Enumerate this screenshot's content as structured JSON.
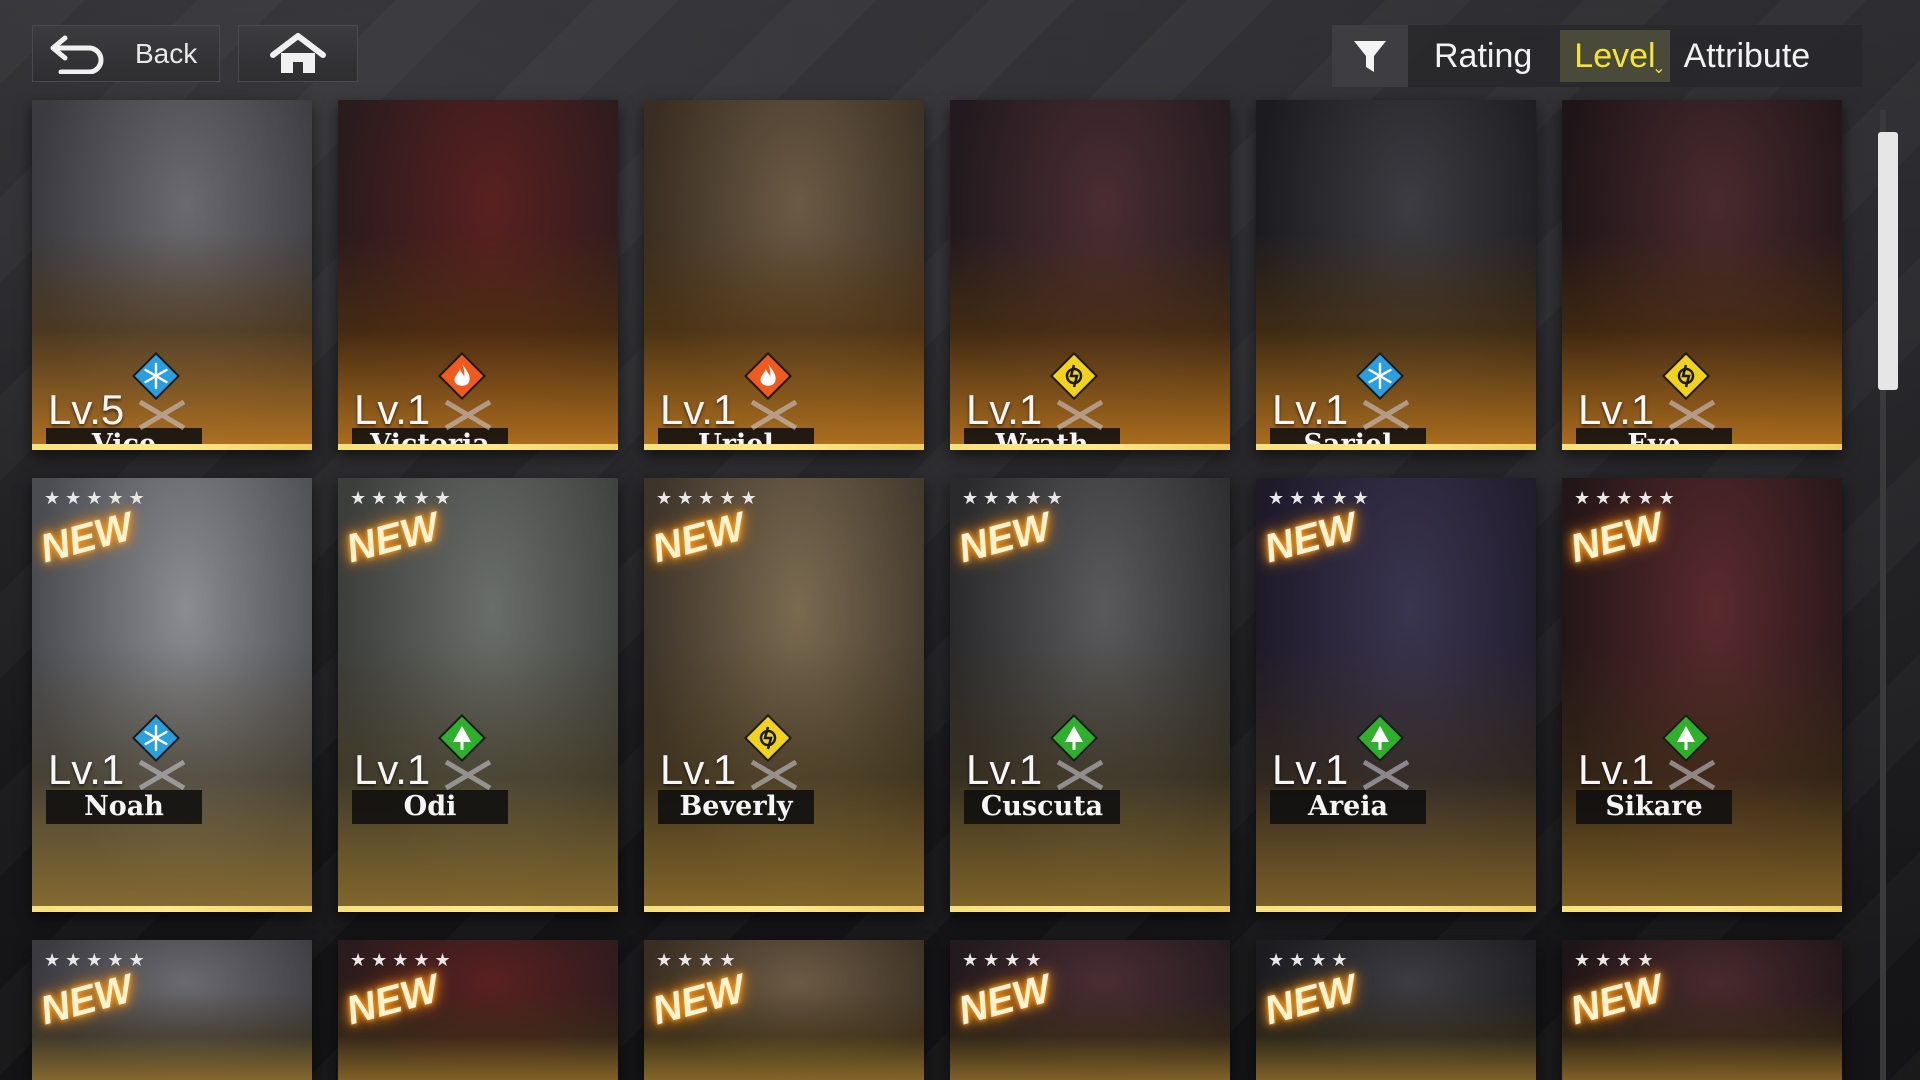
{
  "topbar": {
    "back_label": "Back",
    "home_icon": "home-icon",
    "filter_icon": "filter-icon",
    "sort_options": [
      {
        "label": "Rating",
        "active": false
      },
      {
        "label": "Level",
        "active": true
      },
      {
        "label": "Attribute",
        "active": false
      }
    ]
  },
  "colors": {
    "active_sort": "#f4e43a",
    "ice": "#2a9fe0",
    "fire": "#f05a1e",
    "electric": "#f2d21a",
    "nature": "#2fb02c"
  },
  "rows": [
    {
      "cards": [
        {
          "name": "Vice",
          "level": "Lv.5",
          "attribute": "ice",
          "new": false,
          "stars": ""
        },
        {
          "name": "Victoria",
          "level": "Lv.1",
          "attribute": "fire",
          "new": false,
          "stars": ""
        },
        {
          "name": "Uriel",
          "level": "Lv.1",
          "attribute": "fire",
          "new": false,
          "stars": ""
        },
        {
          "name": "Wrath",
          "level": "Lv.1",
          "attribute": "electric",
          "new": false,
          "stars": ""
        },
        {
          "name": "Sariel",
          "level": "Lv.1",
          "attribute": "ice",
          "new": false,
          "stars": ""
        },
        {
          "name": "Eve",
          "level": "Lv.1",
          "attribute": "electric",
          "new": false,
          "stars": ""
        }
      ]
    },
    {
      "cards": [
        {
          "name": "Noah",
          "level": "Lv.1",
          "attribute": "ice",
          "new": true,
          "stars": "★★★★★"
        },
        {
          "name": "Odi",
          "level": "Lv.1",
          "attribute": "nature",
          "new": true,
          "stars": "★★★★★"
        },
        {
          "name": "Beverly",
          "level": "Lv.1",
          "attribute": "electric",
          "new": true,
          "stars": "★★★★★"
        },
        {
          "name": "Cuscuta",
          "level": "Lv.1",
          "attribute": "nature",
          "new": true,
          "stars": "★★★★★"
        },
        {
          "name": "Areia",
          "level": "Lv.1",
          "attribute": "nature",
          "new": true,
          "stars": "★★★★★"
        },
        {
          "name": "Sikare",
          "level": "Lv.1",
          "attribute": "nature",
          "new": true,
          "stars": "★★★★★"
        }
      ]
    },
    {
      "cards": [
        {
          "name": "",
          "level": "",
          "attribute": "",
          "new": true,
          "stars": "★★★★★"
        },
        {
          "name": "",
          "level": "",
          "attribute": "",
          "new": true,
          "stars": "★★★★★"
        },
        {
          "name": "",
          "level": "",
          "attribute": "",
          "new": true,
          "stars": "★★★★"
        },
        {
          "name": "",
          "level": "",
          "attribute": "",
          "new": true,
          "stars": "★★★★"
        },
        {
          "name": "",
          "level": "",
          "attribute": "",
          "new": true,
          "stars": "★★★★"
        },
        {
          "name": "",
          "level": "",
          "attribute": "",
          "new": true,
          "stars": "★★★★"
        }
      ]
    }
  ],
  "new_badge_text": "NEW"
}
